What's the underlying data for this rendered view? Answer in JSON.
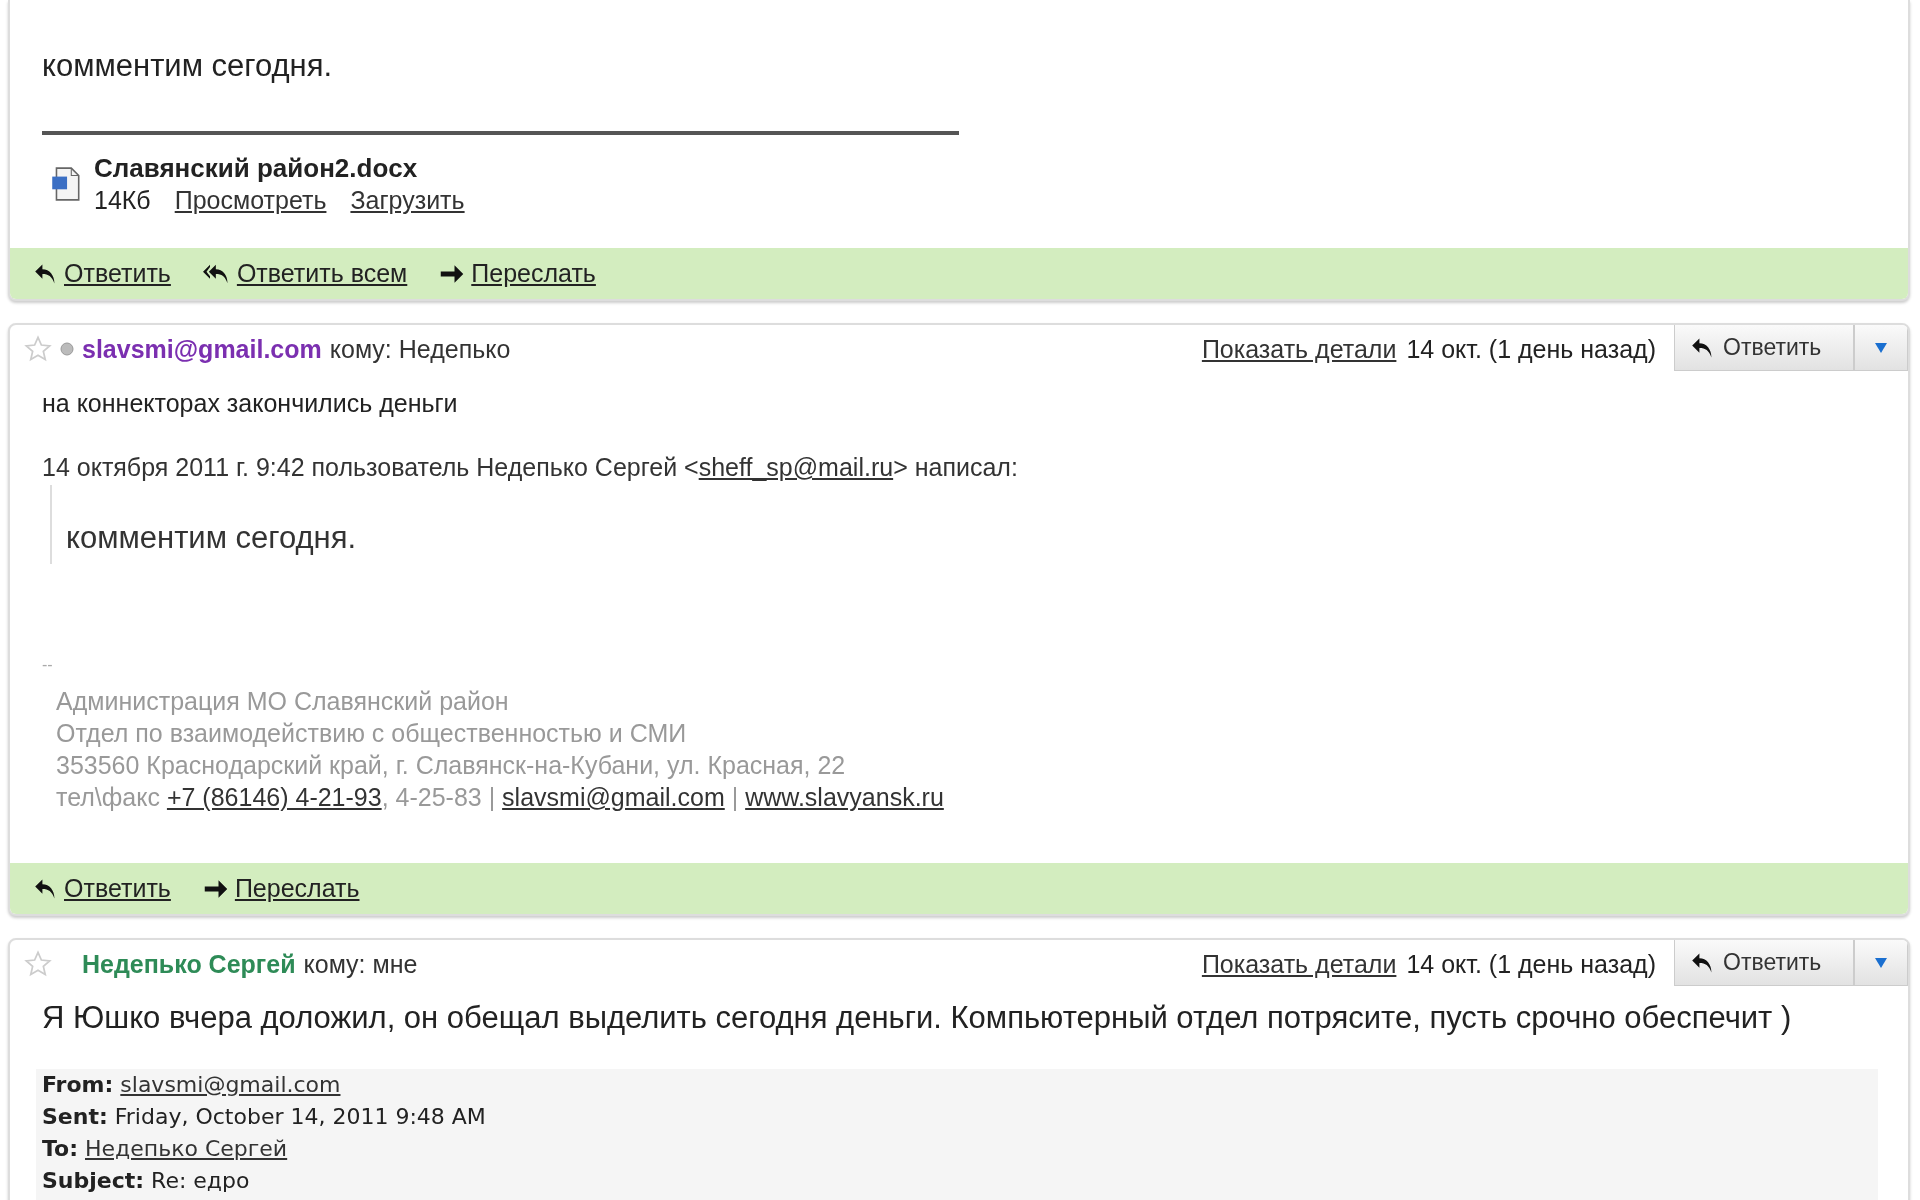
{
  "messages": [
    {
      "body": "комментим сегодня.",
      "attachment": {
        "name": "Славянский район2.docx",
        "size": "14Кб",
        "links": [
          "Просмотреть",
          "Загрузить"
        ]
      },
      "actions": [
        {
          "kind": "reply",
          "label": "Ответить"
        },
        {
          "kind": "reply_all",
          "label": "Ответить всем"
        },
        {
          "kind": "forward",
          "label": "Переслать"
        }
      ]
    },
    {
      "header": {
        "presence_dot": true,
        "sender": "slavsmi@gmail.com",
        "color": "#7b2fb0",
        "to": "кому: Недепько",
        "details": "Показать детали",
        "date": "14 окт. (1 день назад)",
        "reply": "Ответить"
      },
      "body": "на коннекторах закончились деньги",
      "quote_intro": [
        {
          "text": "14 октября 2011 г. 9:42 пользователь Недепько Сергей <",
          "link": false
        },
        {
          "text": "sheff_sp@mail.ru",
          "link": true
        },
        {
          "text": "> написал:",
          "link": false
        }
      ],
      "quote": "комментим сегодня.",
      "signature": {
        "dash": "--",
        "lines": [
          [
            {
              "text": "Администрация МО Славянский район",
              "link": false
            }
          ],
          [
            {
              "text": "Отдел по взаимодействию с общественностью и СМИ",
              "link": false
            }
          ],
          [
            {
              "text": "353560 Краснодарский край, г. Славянск-на-Кубани, ул. Красная, 22",
              "link": false
            }
          ],
          [
            {
              "text": "тел\\факс ",
              "link": false
            },
            {
              "text": "+7 (86146) 4-21-93",
              "link": true
            },
            {
              "text": ", 4-25-83 | ",
              "link": false
            },
            {
              "text": "slavsmi@gmail.com",
              "link": true
            },
            {
              "text": " | ",
              "link": false
            },
            {
              "text": "www.slavyansk.ru",
              "link": true
            }
          ]
        ]
      },
      "actions": [
        {
          "kind": "reply",
          "label": "Ответить"
        },
        {
          "kind": "forward",
          "label": "Переслать"
        }
      ]
    },
    {
      "header": {
        "presence_dot": false,
        "sender": "Недепько Сергей",
        "color": "#2e8b57",
        "to": "кому: мне",
        "details": "Показать детали",
        "date": "14 окт. (1 день назад)",
        "reply": "Ответить"
      },
      "body": "Я Юшко вчера доложил, он обещал выделить сегодня деньги. Компьютерный отдел потрясите, пусть срочно обеспечит )",
      "quoted_headers": [
        {
          "label": "From:",
          "value": "slavsmi@gmail.com",
          "link": true
        },
        {
          "label": "Sent:",
          "value": "Friday, October 14, 2011 9:48 AM",
          "link": false
        },
        {
          "label": "To:",
          "value": "Недепько Сергей",
          "link": true
        },
        {
          "label": "Subject:",
          "value": "Re: едро",
          "link": false
        }
      ]
    }
  ]
}
